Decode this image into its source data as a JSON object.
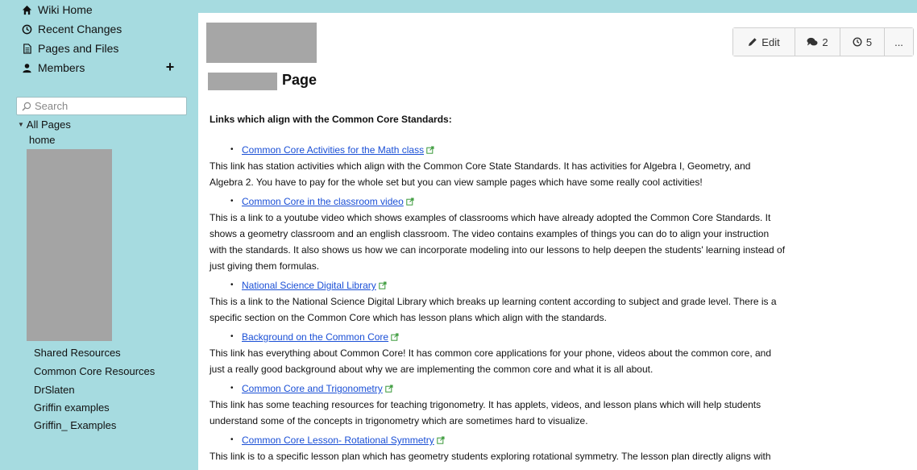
{
  "sidebar": {
    "nav": [
      {
        "label": "Wiki Home",
        "icon": "home-icon"
      },
      {
        "label": "Recent Changes",
        "icon": "clock-icon"
      },
      {
        "label": "Pages and Files",
        "icon": "file-icon"
      },
      {
        "label": "Members",
        "icon": "user-icon"
      }
    ],
    "add_label": "+",
    "search_placeholder": "Search",
    "tree_root": "All Pages",
    "tree_top": [
      "home"
    ],
    "tree_bottom": [
      "Shared Resources",
      "Common Core Resources",
      "DrSlaten",
      "Griffin examples",
      "Griffin_ Examples"
    ]
  },
  "actions": {
    "edit": "Edit",
    "comments": "2",
    "history": "5",
    "more": "..."
  },
  "page": {
    "title": "Page",
    "heading": "Links which align with the Common Core Standards:",
    "entries": [
      {
        "link": "Common Core Activities for the Math class",
        "lines": [
          "This link has station activities which align with the Common Core State Standards. It has activities for Algebra I, Geometry, and",
          "Algebra 2. You have to pay for the whole set but you can view sample pages which have some really cool activities!"
        ]
      },
      {
        "link": "Common Core in the classroom video",
        "lines": [
          "This is a link to a youtube video which shows examples of classrooms which have already adopted the Common Core Standards. It",
          "shows a geometry classroom and an english classroom. The video contains examples of things you can do to align your instruction",
          "with the standards. It also shows us how we can incorporate modeling into our lessons to help deepen the students' learning instead of",
          "just giving them formulas."
        ]
      },
      {
        "link": "National Science Digital Library",
        "lines": [
          "This is a link to the National Science Digital Library which breaks up learning content according to subject and grade level. There is a",
          "specific section on the Common Core which has lesson plans which align with the standards."
        ]
      },
      {
        "link": "Background on the Common Core",
        "lines": [
          "This link has everything about Common Core! It has common core applications for your phone, videos about the common core, and",
          "just a really good background about why we are implementing the common core and what it is all about."
        ]
      },
      {
        "link": "Common Core and Trigonometry",
        "lines": [
          "This link has some teaching resources for teaching trigonometry. It has applets, videos, and lesson plans which will help students",
          "understand some of the concepts in trigonometry which are sometimes hard to visualize."
        ]
      },
      {
        "link": "Common Core Lesson- Rotational Symmetry",
        "lines": [
          "This link is to a specific lesson plan which has geometry students exploring rotational symmetry. The lesson plan directly aligns with"
        ]
      }
    ]
  },
  "colors": {
    "sidebar_bg": "#a6dbe0",
    "link": "#1a4fd6",
    "redaction": "#a6a6a6"
  }
}
